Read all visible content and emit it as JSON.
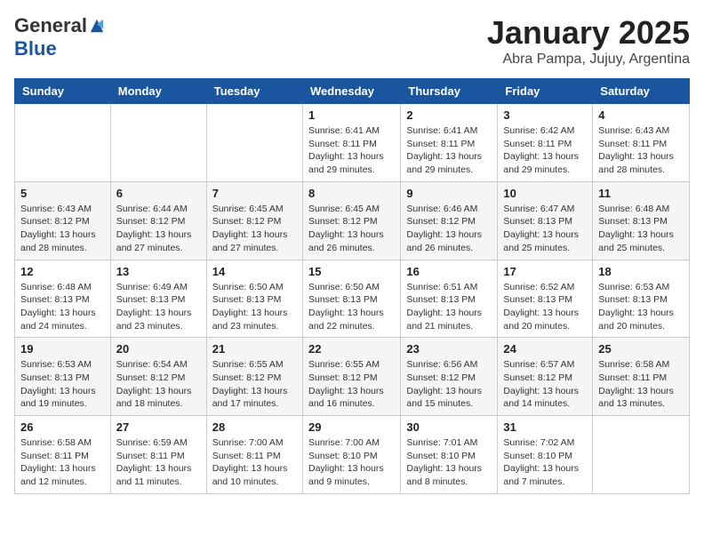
{
  "logo": {
    "general": "General",
    "blue": "Blue"
  },
  "title": {
    "month_year": "January 2025",
    "location": "Abra Pampa, Jujuy, Argentina"
  },
  "weekdays": [
    "Sunday",
    "Monday",
    "Tuesday",
    "Wednesday",
    "Thursday",
    "Friday",
    "Saturday"
  ],
  "weeks": [
    [
      {
        "day": "",
        "info": ""
      },
      {
        "day": "",
        "info": ""
      },
      {
        "day": "",
        "info": ""
      },
      {
        "day": "1",
        "info": "Sunrise: 6:41 AM\nSunset: 8:11 PM\nDaylight: 13 hours\nand 29 minutes."
      },
      {
        "day": "2",
        "info": "Sunrise: 6:41 AM\nSunset: 8:11 PM\nDaylight: 13 hours\nand 29 minutes."
      },
      {
        "day": "3",
        "info": "Sunrise: 6:42 AM\nSunset: 8:11 PM\nDaylight: 13 hours\nand 29 minutes."
      },
      {
        "day": "4",
        "info": "Sunrise: 6:43 AM\nSunset: 8:11 PM\nDaylight: 13 hours\nand 28 minutes."
      }
    ],
    [
      {
        "day": "5",
        "info": "Sunrise: 6:43 AM\nSunset: 8:12 PM\nDaylight: 13 hours\nand 28 minutes."
      },
      {
        "day": "6",
        "info": "Sunrise: 6:44 AM\nSunset: 8:12 PM\nDaylight: 13 hours\nand 27 minutes."
      },
      {
        "day": "7",
        "info": "Sunrise: 6:45 AM\nSunset: 8:12 PM\nDaylight: 13 hours\nand 27 minutes."
      },
      {
        "day": "8",
        "info": "Sunrise: 6:45 AM\nSunset: 8:12 PM\nDaylight: 13 hours\nand 26 minutes."
      },
      {
        "day": "9",
        "info": "Sunrise: 6:46 AM\nSunset: 8:12 PM\nDaylight: 13 hours\nand 26 minutes."
      },
      {
        "day": "10",
        "info": "Sunrise: 6:47 AM\nSunset: 8:13 PM\nDaylight: 13 hours\nand 25 minutes."
      },
      {
        "day": "11",
        "info": "Sunrise: 6:48 AM\nSunset: 8:13 PM\nDaylight: 13 hours\nand 25 minutes."
      }
    ],
    [
      {
        "day": "12",
        "info": "Sunrise: 6:48 AM\nSunset: 8:13 PM\nDaylight: 13 hours\nand 24 minutes."
      },
      {
        "day": "13",
        "info": "Sunrise: 6:49 AM\nSunset: 8:13 PM\nDaylight: 13 hours\nand 23 minutes."
      },
      {
        "day": "14",
        "info": "Sunrise: 6:50 AM\nSunset: 8:13 PM\nDaylight: 13 hours\nand 23 minutes."
      },
      {
        "day": "15",
        "info": "Sunrise: 6:50 AM\nSunset: 8:13 PM\nDaylight: 13 hours\nand 22 minutes."
      },
      {
        "day": "16",
        "info": "Sunrise: 6:51 AM\nSunset: 8:13 PM\nDaylight: 13 hours\nand 21 minutes."
      },
      {
        "day": "17",
        "info": "Sunrise: 6:52 AM\nSunset: 8:13 PM\nDaylight: 13 hours\nand 20 minutes."
      },
      {
        "day": "18",
        "info": "Sunrise: 6:53 AM\nSunset: 8:13 PM\nDaylight: 13 hours\nand 20 minutes."
      }
    ],
    [
      {
        "day": "19",
        "info": "Sunrise: 6:53 AM\nSunset: 8:13 PM\nDaylight: 13 hours\nand 19 minutes."
      },
      {
        "day": "20",
        "info": "Sunrise: 6:54 AM\nSunset: 8:12 PM\nDaylight: 13 hours\nand 18 minutes."
      },
      {
        "day": "21",
        "info": "Sunrise: 6:55 AM\nSunset: 8:12 PM\nDaylight: 13 hours\nand 17 minutes."
      },
      {
        "day": "22",
        "info": "Sunrise: 6:55 AM\nSunset: 8:12 PM\nDaylight: 13 hours\nand 16 minutes."
      },
      {
        "day": "23",
        "info": "Sunrise: 6:56 AM\nSunset: 8:12 PM\nDaylight: 13 hours\nand 15 minutes."
      },
      {
        "day": "24",
        "info": "Sunrise: 6:57 AM\nSunset: 8:12 PM\nDaylight: 13 hours\nand 14 minutes."
      },
      {
        "day": "25",
        "info": "Sunrise: 6:58 AM\nSunset: 8:11 PM\nDaylight: 13 hours\nand 13 minutes."
      }
    ],
    [
      {
        "day": "26",
        "info": "Sunrise: 6:58 AM\nSunset: 8:11 PM\nDaylight: 13 hours\nand 12 minutes."
      },
      {
        "day": "27",
        "info": "Sunrise: 6:59 AM\nSunset: 8:11 PM\nDaylight: 13 hours\nand 11 minutes."
      },
      {
        "day": "28",
        "info": "Sunrise: 7:00 AM\nSunset: 8:11 PM\nDaylight: 13 hours\nand 10 minutes."
      },
      {
        "day": "29",
        "info": "Sunrise: 7:00 AM\nSunset: 8:10 PM\nDaylight: 13 hours\nand 9 minutes."
      },
      {
        "day": "30",
        "info": "Sunrise: 7:01 AM\nSunset: 8:10 PM\nDaylight: 13 hours\nand 8 minutes."
      },
      {
        "day": "31",
        "info": "Sunrise: 7:02 AM\nSunset: 8:10 PM\nDaylight: 13 hours\nand 7 minutes."
      },
      {
        "day": "",
        "info": ""
      }
    ]
  ]
}
